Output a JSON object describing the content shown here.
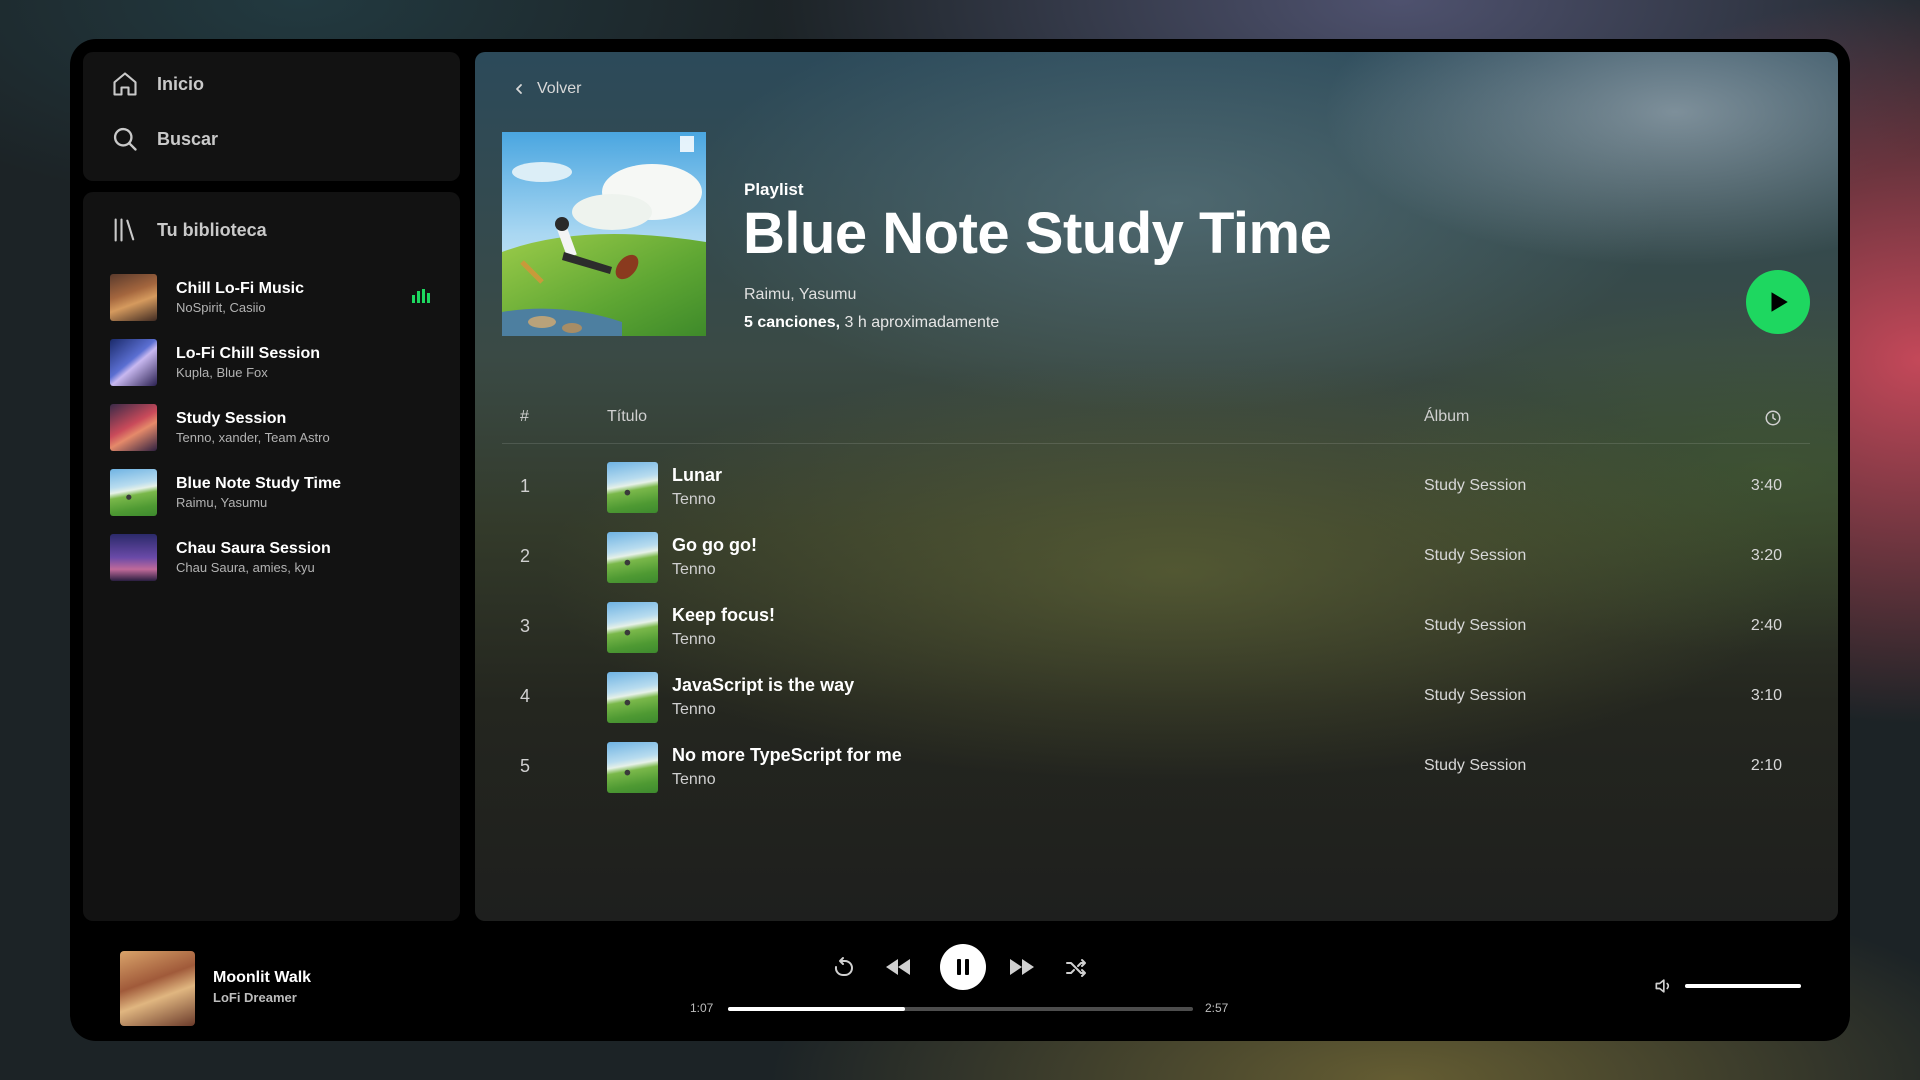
{
  "nav": {
    "home_label": "Inicio",
    "search_label": "Buscar"
  },
  "library": {
    "title": "Tu biblioteca",
    "items": [
      {
        "title": "Chill Lo-Fi Music",
        "subtitle": "NoSpirit, Casiio",
        "playing": true
      },
      {
        "title": "Lo-Fi Chill Session",
        "subtitle": "Kupla, Blue Fox",
        "playing": false
      },
      {
        "title": "Study Session",
        "subtitle": "Tenno, xander, Team Astro",
        "playing": false
      },
      {
        "title": "Blue Note Study Time",
        "subtitle": "Raimu, Yasumu",
        "playing": false
      },
      {
        "title": "Chau Saura Session",
        "subtitle": "Chau Saura, amies, kyu",
        "playing": false
      }
    ]
  },
  "main": {
    "back_label": "Volver",
    "playlist_type": "Playlist",
    "playlist_title": "Blue Note Study Time",
    "playlist_artists": "Raimu, Yasumu",
    "song_count": "5 canciones,",
    "duration_text": "3 h aproximadamente"
  },
  "table": {
    "col_number": "#",
    "col_title": "Título",
    "col_album": "Álbum",
    "rows": [
      {
        "num": "1",
        "title": "Lunar",
        "artist": "Tenno",
        "album": "Study Session",
        "duration": "3:40"
      },
      {
        "num": "2",
        "title": "Go go go!",
        "artist": "Tenno",
        "album": "Study Session",
        "duration": "3:20"
      },
      {
        "num": "3",
        "title": "Keep focus!",
        "artist": "Tenno",
        "album": "Study Session",
        "duration": "2:40"
      },
      {
        "num": "4",
        "title": "JavaScript is the way",
        "artist": "Tenno",
        "album": "Study Session",
        "duration": "3:10"
      },
      {
        "num": "5",
        "title": "No more TypeScript for me",
        "artist": "Tenno",
        "album": "Study Session",
        "duration": "2:10"
      }
    ]
  },
  "player": {
    "track_title": "Moonlit Walk",
    "track_artist": "LoFi Dreamer",
    "elapsed": "1:07",
    "total": "2:57",
    "progress_fraction": 0.38,
    "volume_fraction": 1.0
  },
  "colors": {
    "accent": "#1ed760",
    "panel": "#121212",
    "player_bg": "#000000"
  },
  "icons": [
    "home-icon",
    "search-icon",
    "library-icon",
    "chevron-left-icon",
    "play-icon",
    "clock-icon",
    "repeat-icon",
    "previous-icon",
    "pause-icon",
    "next-icon",
    "shuffle-icon",
    "volume-icon"
  ]
}
